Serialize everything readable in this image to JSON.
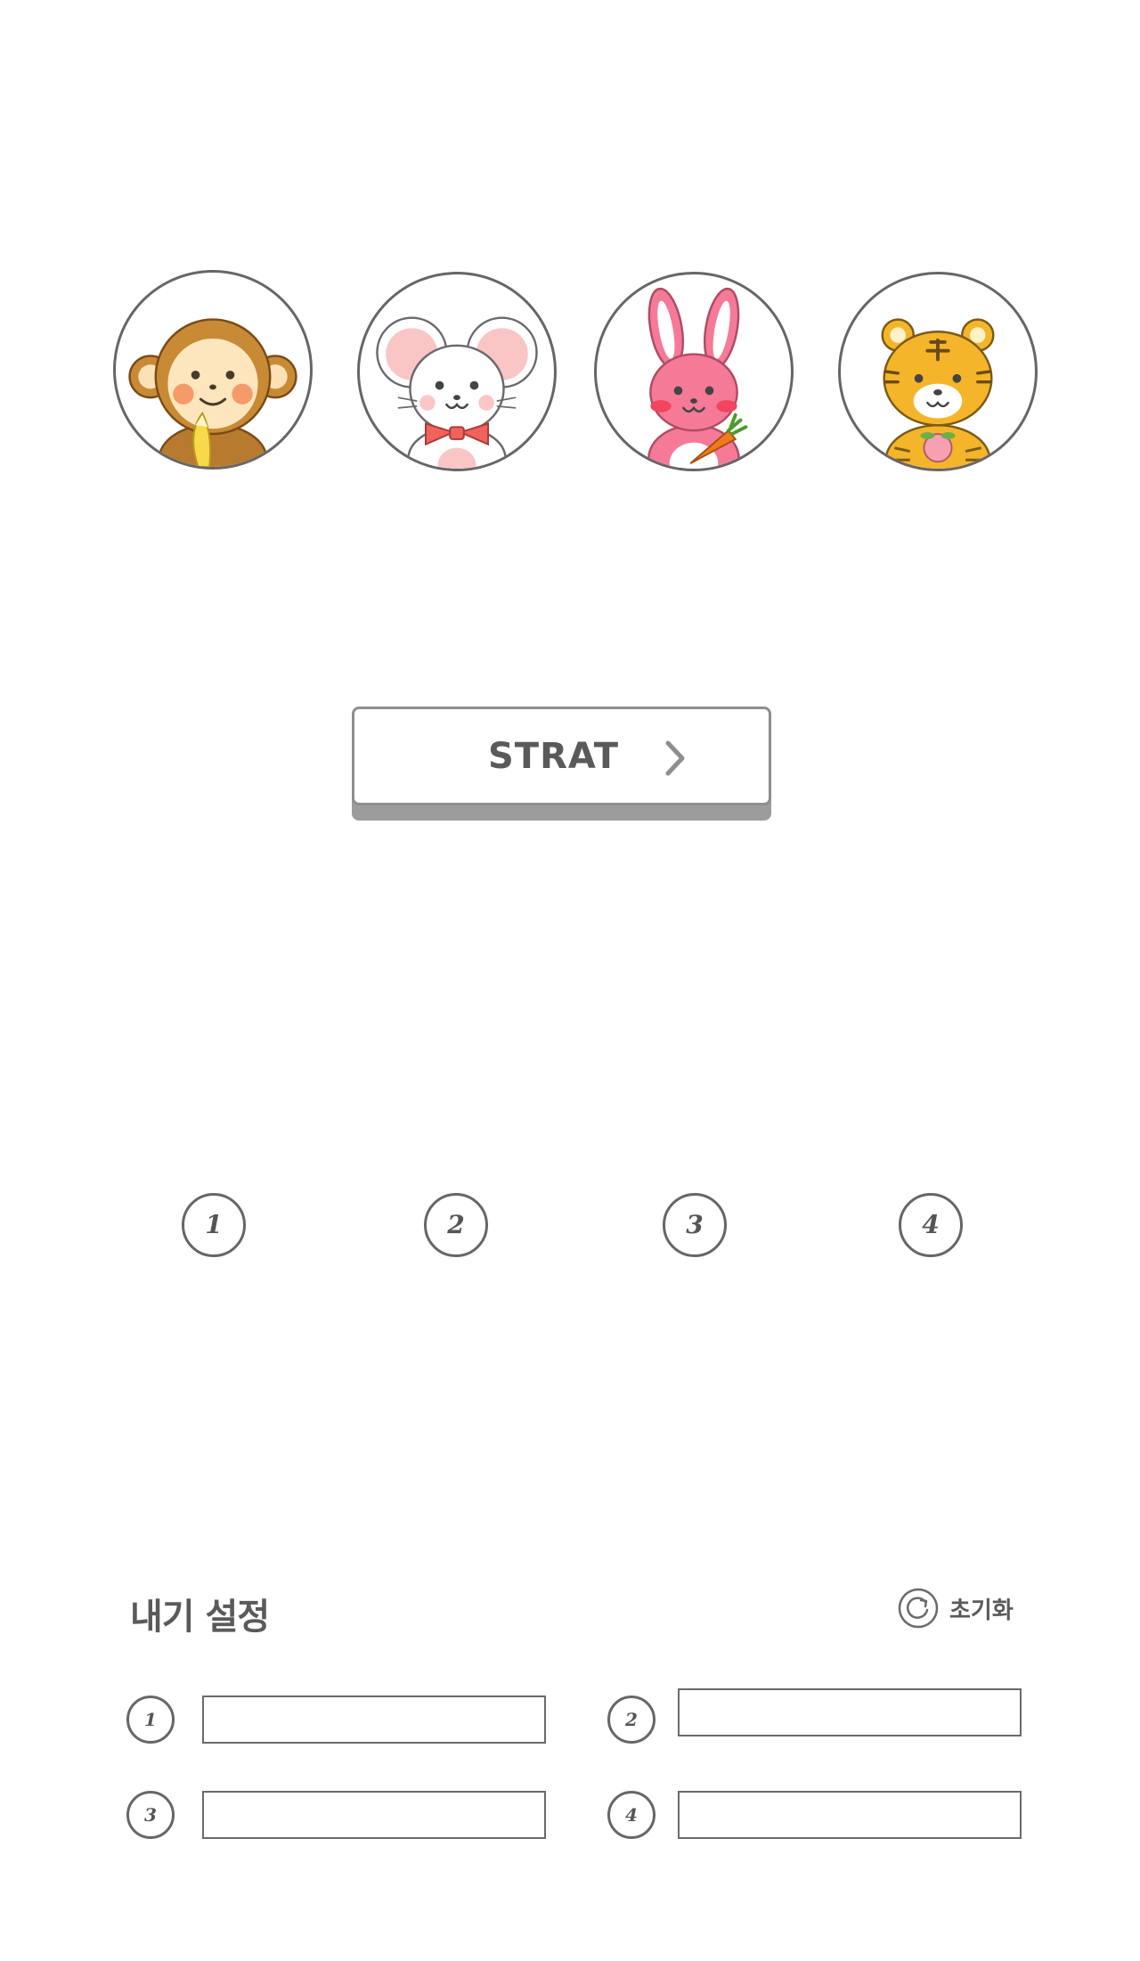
{
  "animals": [
    {
      "id": "monkey",
      "icon": "monkey-icon"
    },
    {
      "id": "mouse",
      "icon": "mouse-icon"
    },
    {
      "id": "rabbit",
      "icon": "rabbit-icon"
    },
    {
      "id": "tiger",
      "icon": "tiger-icon"
    }
  ],
  "start_button": {
    "label": "STRAT",
    "icon": "chevron-right-icon"
  },
  "players": [
    "1",
    "2",
    "3",
    "4"
  ],
  "bet_settings": {
    "title": "내기 설정",
    "reset_label": "초기화",
    "reset_icon": "refresh-icon",
    "entries": [
      {
        "number": "1",
        "value": ""
      },
      {
        "number": "2",
        "value": ""
      },
      {
        "number": "3",
        "value": ""
      },
      {
        "number": "4",
        "value": ""
      }
    ]
  },
  "colors": {
    "outline": "#666666",
    "button_shadow": "#9c9c9c",
    "text": "#5a5a5a",
    "background": "#ffffff"
  }
}
